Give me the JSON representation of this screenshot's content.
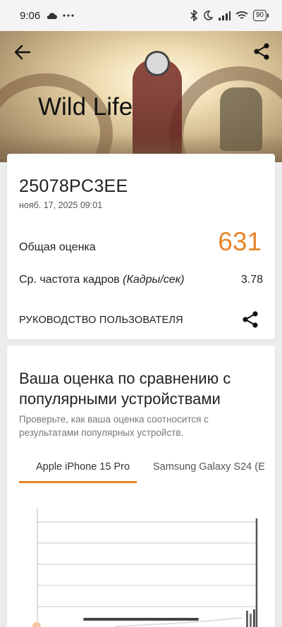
{
  "status_bar": {
    "time": "9:06",
    "battery": "90"
  },
  "hero": {
    "title": "Wild Life"
  },
  "result": {
    "device": "25078PC3EE",
    "date": "нояб. 17, 2025 09:01",
    "score_label": "Общая оценка",
    "score_value": "631",
    "fps_label": "Ср. частота кадров",
    "fps_unit": "(Кадры/сек)",
    "fps_value": "3.78",
    "guide_label": "РУКОВОДСТВО ПОЛЬЗОВАТЕЛЯ"
  },
  "comparison": {
    "heading": "Ваша оценка по сравнению с популярными устройствами",
    "subtitle": "Проверьте, как ваша оценка соотносится с результатами популярных устройств.",
    "tabs": [
      {
        "label": "Apple iPhone 15 Pro",
        "active": true
      },
      {
        "label": "Samsung Galaxy S24 (E",
        "active": false
      }
    ]
  },
  "colors": {
    "accent": "#e8852a"
  },
  "icons": [
    "back-arrow-icon",
    "share-icon",
    "cloud-icon",
    "more-icon",
    "bluetooth-icon",
    "moon-icon",
    "signal-icon",
    "wifi-icon",
    "battery-icon"
  ]
}
